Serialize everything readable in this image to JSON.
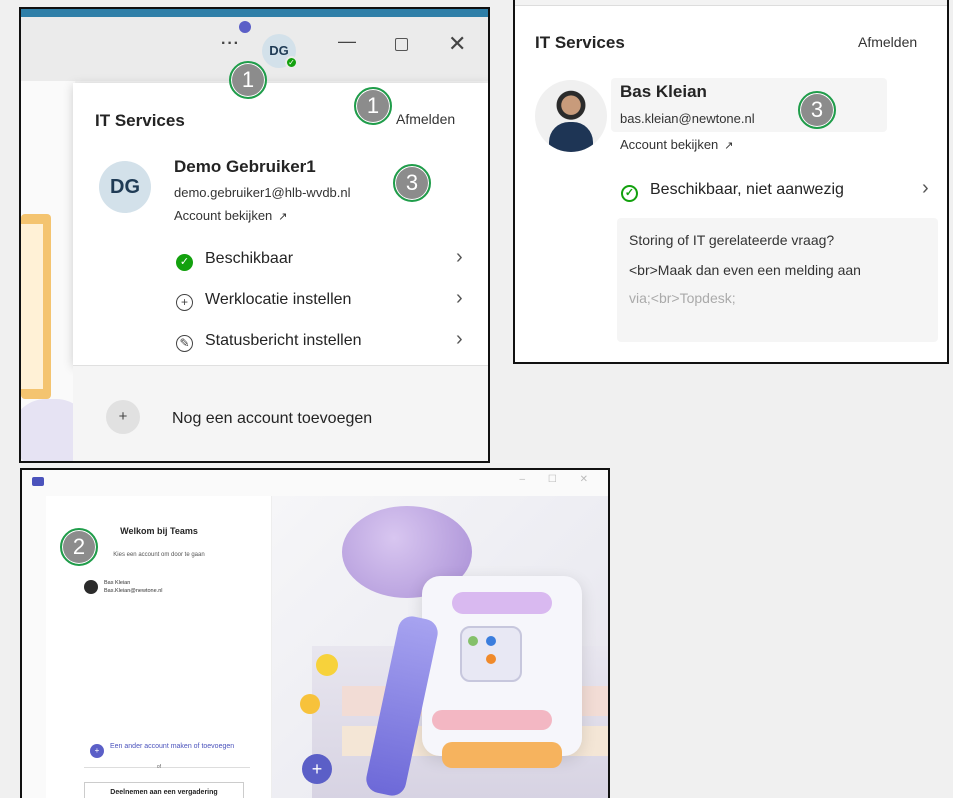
{
  "panel1": {
    "titlebar": {
      "more": "···",
      "avatar_initials": "DG",
      "avatar_status": "✓",
      "minimize": "—",
      "close": "✕"
    },
    "org": "IT Services",
    "signout": "Afmelden",
    "avatar_initials": "DG",
    "user_name": "Demo Gebruiker1",
    "user_email": "demo.gebruiker1@hlb-wvdb.nl",
    "view_account": "Account bekijken",
    "ext_icon": "↗",
    "menu": [
      {
        "label": "Beschikbaar",
        "icon": "✓"
      },
      {
        "label": "Werklocatie instellen",
        "icon": "+"
      },
      {
        "label": "Statusbericht instellen",
        "icon": "✎"
      }
    ],
    "chevron": "›",
    "add_account": "Nog een account toevoegen",
    "add_icon": "+",
    "badges": [
      "1",
      "1",
      "3"
    ]
  },
  "panel2": {
    "org": "IT Services",
    "signout": "Afmelden",
    "user_name": "Bas Kleian",
    "user_email": "bas.kleian@newtone.nl",
    "view_account": "Account bekijken",
    "ext_icon": "↗",
    "status": "Beschikbaar, niet aanwezig",
    "status_icon": "✓",
    "chevron": "›",
    "note_lines": [
      "Storing of IT gerelateerde vraag?",
      "<br>Maak dan even een melding aan",
      "via;<br>Topdesk;"
    ],
    "badge": "3"
  },
  "panel3": {
    "title": "Welkom bij Teams",
    "subtitle": "Kies een account om door te gaan",
    "account_name": "Bas Kleian",
    "account_email": "Bas.Kleian@newtone.nl",
    "add_account": "Een ander account maken of toevoegen",
    "or": "of",
    "join_meeting": "Deelnemen aan een vergadering",
    "window_controls": "– ☐ ✕",
    "badge": "2"
  },
  "colors": {
    "available": "#13a10e",
    "teams_purple": "#5b5fc7",
    "badge_grey": "#8c8c8c",
    "badge_ring": "#1f9d4a"
  }
}
